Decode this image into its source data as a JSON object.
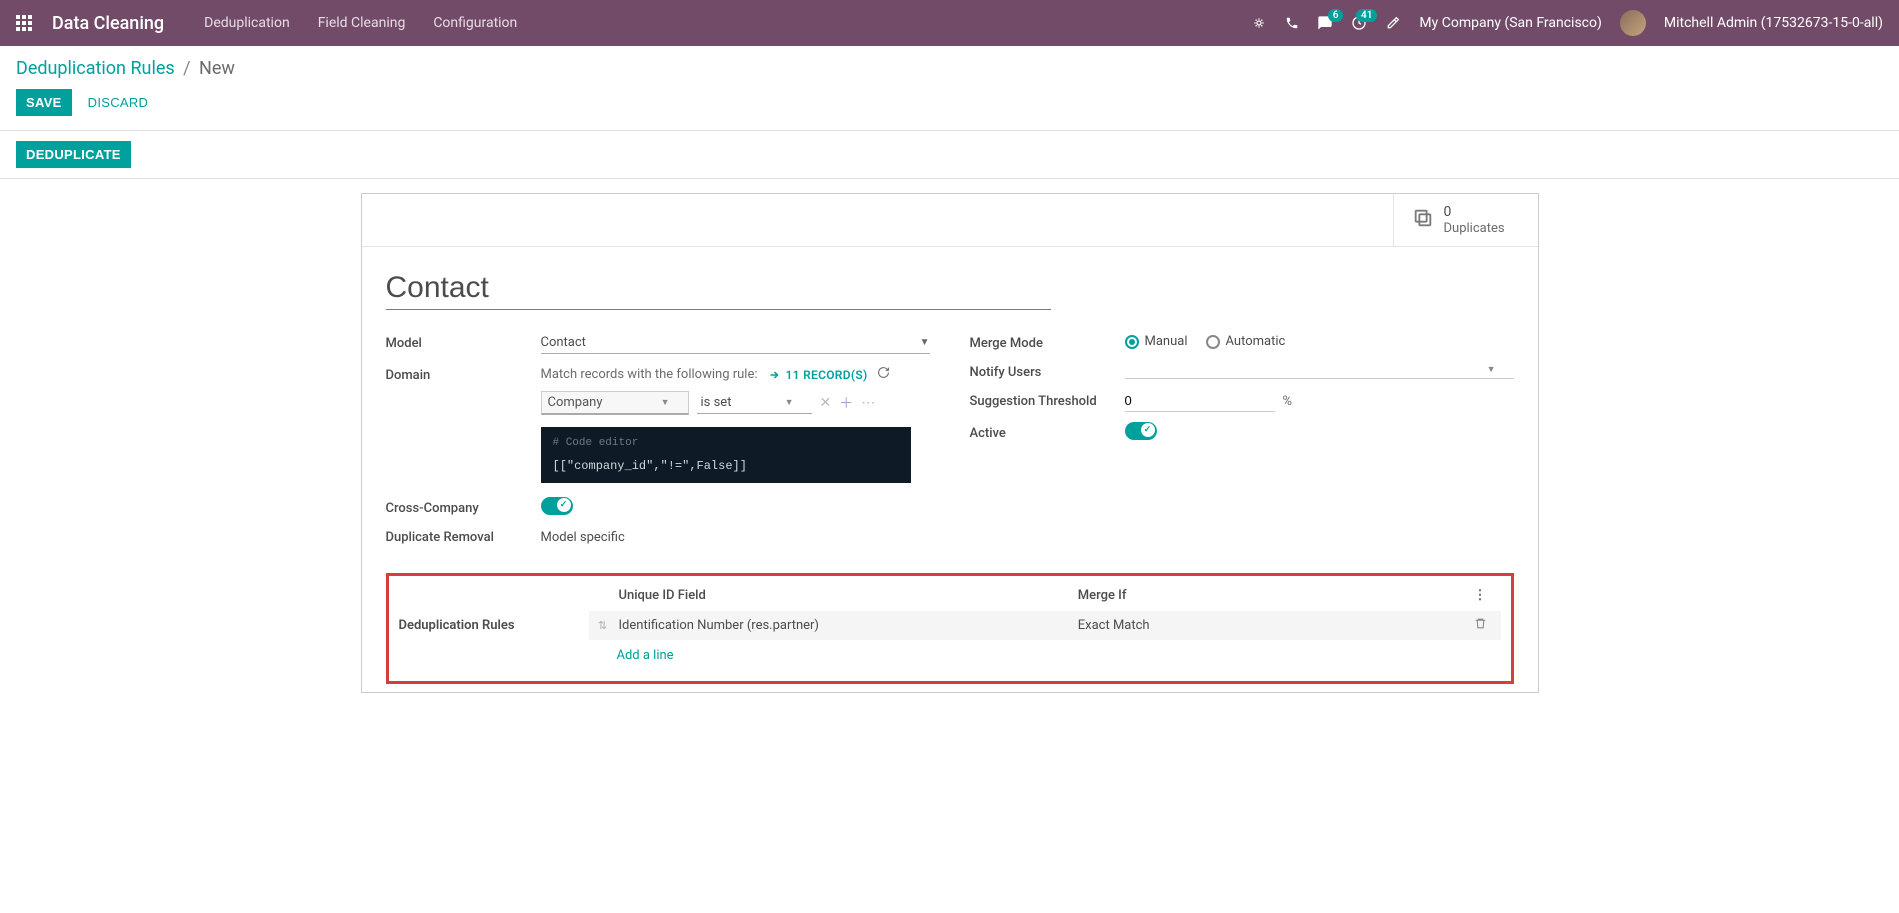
{
  "topbar": {
    "app_title": "Data Cleaning",
    "menu": [
      "Deduplication",
      "Field Cleaning",
      "Configuration"
    ],
    "messages_badge": "6",
    "activities_badge": "41",
    "company": "My Company (San Francisco)",
    "user": "Mitchell Admin (17532673-15-0-all)"
  },
  "breadcrumb": {
    "root": "Deduplication Rules",
    "current": "New"
  },
  "actions": {
    "save": "SAVE",
    "discard": "DISCARD",
    "deduplicate": "DEDUPLICATE"
  },
  "stat": {
    "count": "0",
    "label": "Duplicates"
  },
  "title": "Contact",
  "labels": {
    "model": "Model",
    "domain": "Domain",
    "cross_company": "Cross-Company",
    "dup_removal": "Duplicate Removal",
    "merge_mode": "Merge Mode",
    "notify": "Notify Users",
    "threshold": "Suggestion Threshold",
    "active": "Active"
  },
  "model_value": "Contact",
  "domain": {
    "match_text": "Match records with the following rule:",
    "records_text": "11 RECORD(S)",
    "field": "Company",
    "operator": "is set",
    "code_comment": "# Code editor",
    "code": "[[\"company_id\",\"!=\",False]]"
  },
  "dup_removal_value": "Model specific",
  "merge_mode": {
    "manual": "Manual",
    "auto": "Automatic"
  },
  "threshold_value": "0",
  "pct_sign": "%",
  "rules": {
    "section_title": "Deduplication Rules",
    "col_field": "Unique ID Field",
    "col_merge": "Merge If",
    "row_field": "Identification Number (res.partner)",
    "row_merge": "Exact Match",
    "add_line": "Add a line"
  }
}
